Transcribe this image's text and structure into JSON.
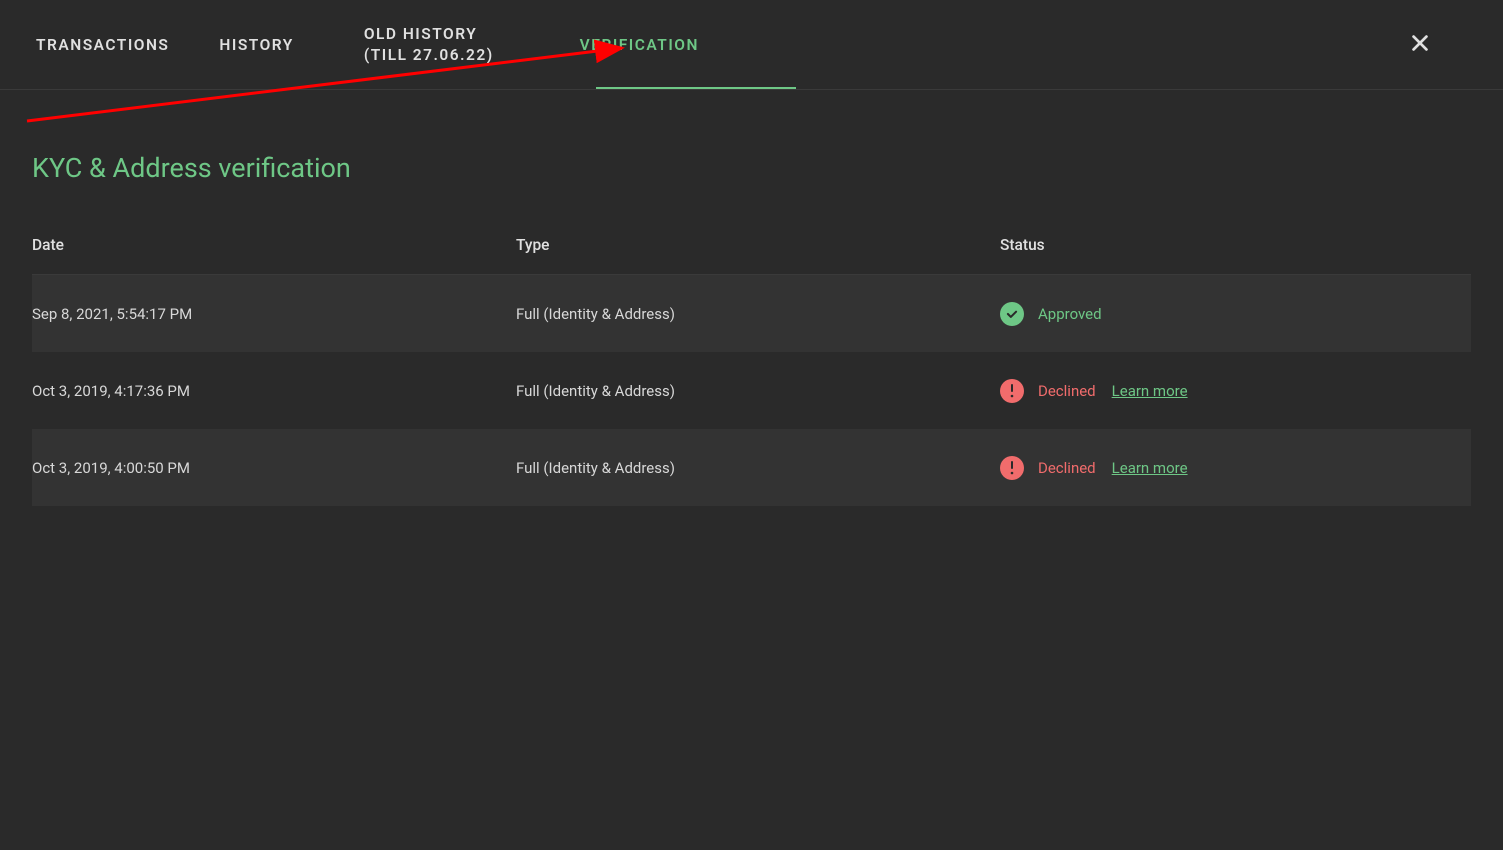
{
  "tabs": {
    "transactions": "TRANSACTIONS",
    "history": "HISTORY",
    "old_history_line1": "OLD HISTORY",
    "old_history_line2": "(TILL 27.06.22)",
    "verification": "VERIFICATION"
  },
  "page_title": "KYC & Address verification",
  "table": {
    "headers": {
      "date": "Date",
      "type": "Type",
      "status": "Status"
    },
    "rows": [
      {
        "date": "Sep 8, 2021, 5:54:17 PM",
        "type": "Full (Identity & Address)",
        "status": "Approved",
        "status_kind": "approved"
      },
      {
        "date": "Oct 3, 2019, 4:17:36 PM",
        "type": "Full (Identity & Address)",
        "status": "Declined",
        "status_kind": "declined",
        "learn_more": "Learn more"
      },
      {
        "date": "Oct 3, 2019, 4:00:50 PM",
        "type": "Full (Identity & Address)",
        "status": "Declined",
        "status_kind": "declined",
        "learn_more": "Learn more"
      }
    ]
  },
  "colors": {
    "accent_green": "#6ec786",
    "accent_red": "#f16c6c",
    "bg": "#2a2a2a",
    "bg_alt": "#333333"
  }
}
